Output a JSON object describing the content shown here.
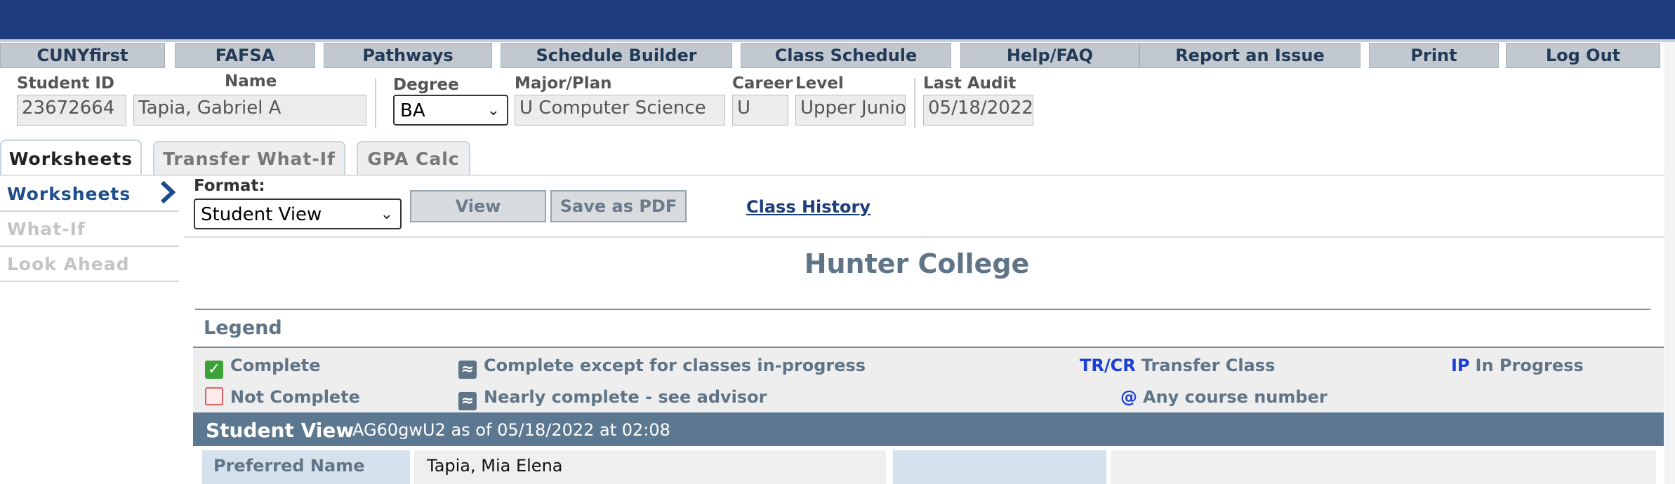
{
  "nav": [
    "CUNYfirst",
    "FAFSA",
    "Pathways",
    "Schedule Builder",
    "Class Schedule",
    "Help/FAQ",
    "Report an Issue",
    "Print",
    "Log Out"
  ],
  "header": {
    "student_id_label": "Student ID",
    "student_id": "23672664",
    "name_label": "Name",
    "name": "Tapia, Gabriel A",
    "degree_label": "Degree",
    "degree": "BA",
    "major_label": "Major/Plan",
    "major": "U Computer Science",
    "career_label": "Career",
    "career": "U",
    "level_label": "Level",
    "level": "Upper Junior",
    "audit_label": "Last Audit",
    "audit": "05/18/2022"
  },
  "tabs": [
    "Worksheets",
    "Transfer What-If",
    "GPA Calc"
  ],
  "left_menu": [
    "Worksheets",
    "What-If",
    "Look Ahead"
  ],
  "format": {
    "label": "Format:",
    "value": "Student View"
  },
  "buttons": {
    "view": "View",
    "pdf": "Save as PDF"
  },
  "class_history": "Class History",
  "college": "Hunter College",
  "legend": {
    "title": "Legend",
    "complete": "Complete",
    "not_complete": "Not Complete",
    "inprogress": "Complete except for classes in-progress",
    "nearly": "Nearly complete - see advisor",
    "trcr_code": "TR/CR",
    "trcr": "Transfer Class",
    "ip_code": "IP",
    "ip": "In Progress",
    "any_code": "@",
    "any": "Any course number"
  },
  "student_view": {
    "title": "Student View",
    "info": "AG60gwU2 as of 05/18/2022 at 02:08"
  },
  "preferred": {
    "label": "Preferred Name",
    "value": "Tapia, Mia Elena"
  }
}
